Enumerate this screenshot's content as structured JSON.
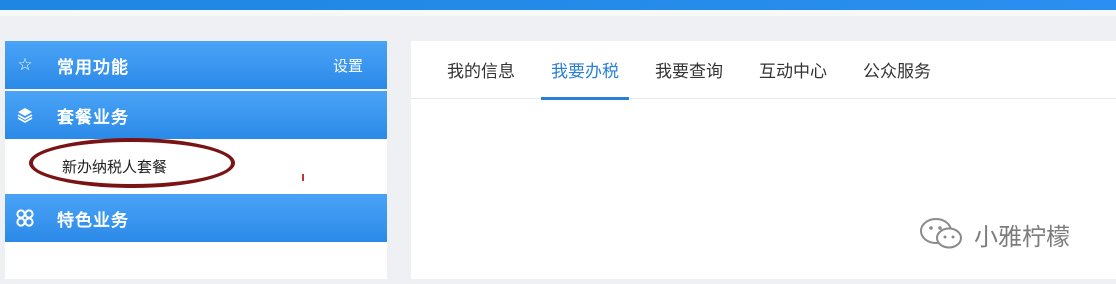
{
  "sidebar": {
    "common": {
      "label": "常用功能",
      "icon": "star-icon",
      "setting_label": "设置"
    },
    "package": {
      "label": "套餐业务",
      "icon": "layers-icon",
      "items": [
        "新办纳税人套餐"
      ]
    },
    "feature": {
      "label": "特色业务",
      "icon": "clover-icon"
    }
  },
  "main": {
    "tabs": [
      {
        "label": "我的信息",
        "active": false
      },
      {
        "label": "我要办税",
        "active": true
      },
      {
        "label": "我要查询",
        "active": false
      },
      {
        "label": "互动中心",
        "active": false
      },
      {
        "label": "公众服务",
        "active": false
      }
    ]
  },
  "watermark": {
    "text": "小雅柠檬",
    "icon": "wechat-icon"
  },
  "colors": {
    "accent": "#2a7fd6",
    "sidebar_header": "#3b96ef",
    "highlight_ring": "#7a1414"
  }
}
